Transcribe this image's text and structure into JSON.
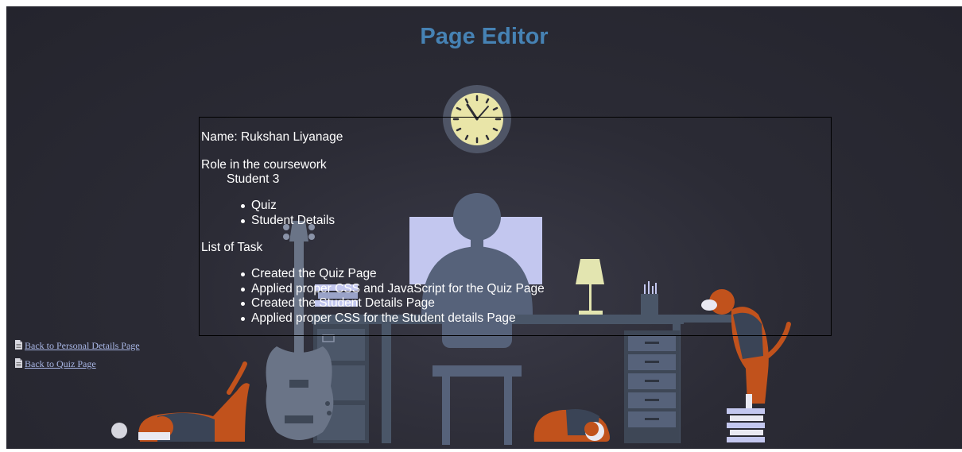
{
  "page": {
    "title": "Page Editor"
  },
  "details": {
    "name_line": "Name: Rukshan Liyanage",
    "role_heading": "Role in the coursework",
    "role_value": "Student 3",
    "role_items": [
      "Quiz",
      "Student Details"
    ],
    "tasks_heading": "List of Task",
    "task_items": [
      "Created the Quiz Page",
      "Applied proper CSS and JavaScript for the Quiz Page",
      "Created the Student Details Page",
      "Applied proper CSS for the Student details Page"
    ]
  },
  "links": [
    {
      "label": "Back to Personal Details Page",
      "icon": "document-icon"
    },
    {
      "label": "Back to Quiz Page",
      "icon": "document-icon"
    }
  ],
  "colors": {
    "background": "#2b2b35",
    "title": "#4682b4",
    "text": "#ffffff",
    "link": "#a9b7e6",
    "monitor": "#c3c7ef",
    "dog_orange": "#c1521c",
    "clock_face": "#e9e5a8",
    "lamp": "#e3e5b0"
  }
}
